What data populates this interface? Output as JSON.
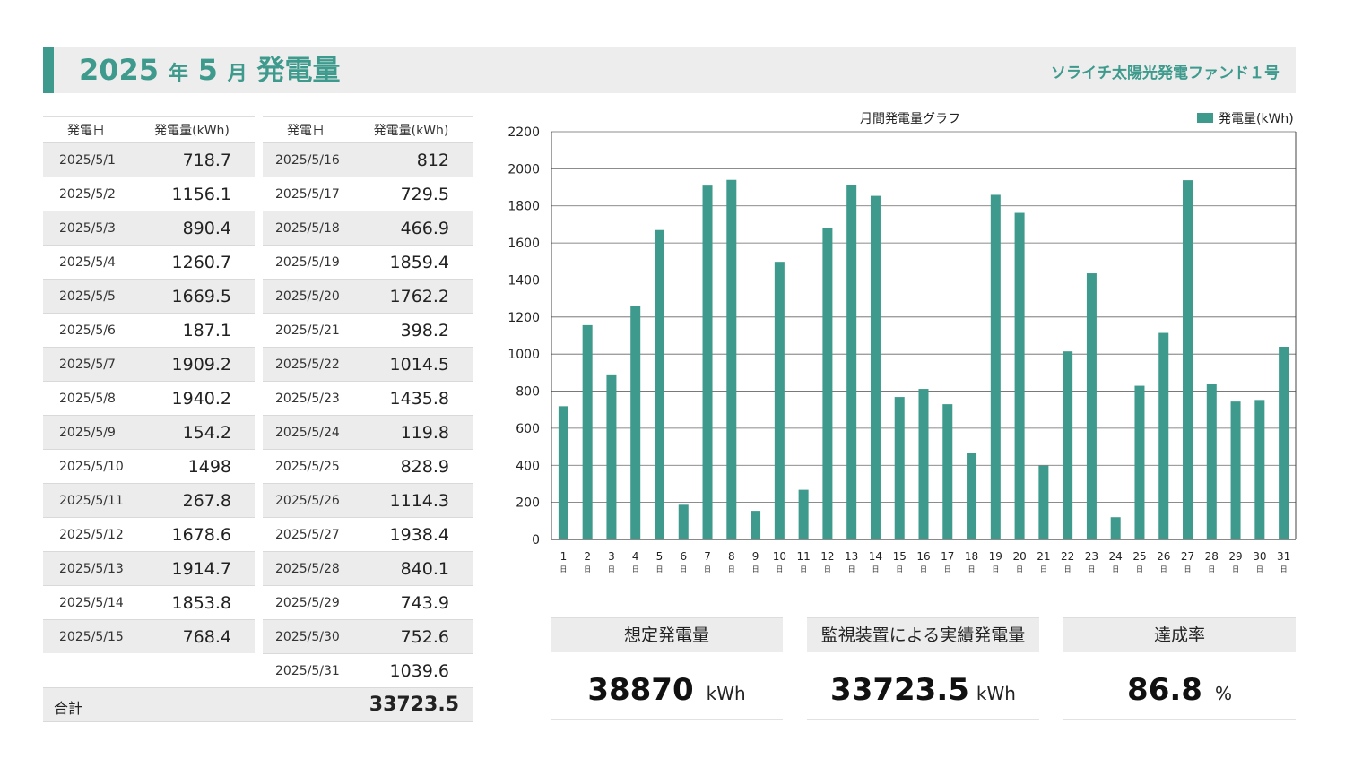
{
  "header": {
    "year": "2025",
    "year_suffix": "年",
    "month": "5",
    "month_suffix": "月",
    "title_label": "発電量",
    "fund_name": "ソライチ太陽光発電ファンド１号"
  },
  "table": {
    "col_date": "発電日",
    "col_value": "発電量(kWh)",
    "left_rows": [
      {
        "date": "2025/5/1",
        "value": "718.7"
      },
      {
        "date": "2025/5/2",
        "value": "1156.1"
      },
      {
        "date": "2025/5/3",
        "value": "890.4"
      },
      {
        "date": "2025/5/4",
        "value": "1260.7"
      },
      {
        "date": "2025/5/5",
        "value": "1669.5"
      },
      {
        "date": "2025/5/6",
        "value": "187.1"
      },
      {
        "date": "2025/5/7",
        "value": "1909.2"
      },
      {
        "date": "2025/5/8",
        "value": "1940.2"
      },
      {
        "date": "2025/5/9",
        "value": "154.2"
      },
      {
        "date": "2025/5/10",
        "value": "1498"
      },
      {
        "date": "2025/5/11",
        "value": "267.8"
      },
      {
        "date": "2025/5/12",
        "value": "1678.6"
      },
      {
        "date": "2025/5/13",
        "value": "1914.7"
      },
      {
        "date": "2025/5/14",
        "value": "1853.8"
      },
      {
        "date": "2025/5/15",
        "value": "768.4"
      }
    ],
    "right_rows": [
      {
        "date": "2025/5/16",
        "value": "812"
      },
      {
        "date": "2025/5/17",
        "value": "729.5"
      },
      {
        "date": "2025/5/18",
        "value": "466.9"
      },
      {
        "date": "2025/5/19",
        "value": "1859.4"
      },
      {
        "date": "2025/5/20",
        "value": "1762.2"
      },
      {
        "date": "2025/5/21",
        "value": "398.2"
      },
      {
        "date": "2025/5/22",
        "value": "1014.5"
      },
      {
        "date": "2025/5/23",
        "value": "1435.8"
      },
      {
        "date": "2025/5/24",
        "value": "119.8"
      },
      {
        "date": "2025/5/25",
        "value": "828.9"
      },
      {
        "date": "2025/5/26",
        "value": "1114.3"
      },
      {
        "date": "2025/5/27",
        "value": "1938.4"
      },
      {
        "date": "2025/5/28",
        "value": "840.1"
      },
      {
        "date": "2025/5/29",
        "value": "743.9"
      },
      {
        "date": "2025/5/30",
        "value": "752.6"
      },
      {
        "date": "2025/5/31",
        "value": "1039.6"
      }
    ],
    "total_label": "合計",
    "total_value": "33723.5"
  },
  "kpis": [
    {
      "label": "想定発電量",
      "value": "38870",
      "unit": "kWh"
    },
    {
      "label": "監視装置による実績発電量",
      "value": "33723.5",
      "unit": "kWh"
    },
    {
      "label": "達成率",
      "value": "86.8",
      "unit": "%"
    }
  ],
  "colors": {
    "accent": "#3d9a8c",
    "bar": "#3d9a8c",
    "shade": "#ececec"
  },
  "chart_data": {
    "type": "bar",
    "title": "月間発電量グラフ",
    "legend": "発電量(kWh)",
    "legend_position": "top-right",
    "grid": true,
    "ylim": [
      0,
      2200
    ],
    "yticks": [
      0,
      200,
      400,
      600,
      800,
      1000,
      1200,
      1400,
      1600,
      1800,
      2000,
      2200
    ],
    "categories": [
      "1",
      "2",
      "3",
      "4",
      "5",
      "6",
      "7",
      "8",
      "9",
      "10",
      "11",
      "12",
      "13",
      "14",
      "15",
      "16",
      "17",
      "18",
      "19",
      "20",
      "21",
      "22",
      "23",
      "24",
      "25",
      "26",
      "27",
      "28",
      "29",
      "30",
      "31"
    ],
    "category_suffix": "日",
    "series": [
      {
        "name": "発電量(kWh)",
        "values": [
          718.7,
          1156.1,
          890.4,
          1260.7,
          1669.5,
          187.1,
          1909.2,
          1940.2,
          154.2,
          1498,
          267.8,
          1678.6,
          1914.7,
          1853.8,
          768.4,
          812,
          729.5,
          466.9,
          1859.4,
          1762.2,
          398.2,
          1014.5,
          1435.8,
          119.8,
          828.9,
          1114.3,
          1938.4,
          840.1,
          743.9,
          752.6,
          1039.6
        ]
      }
    ]
  }
}
